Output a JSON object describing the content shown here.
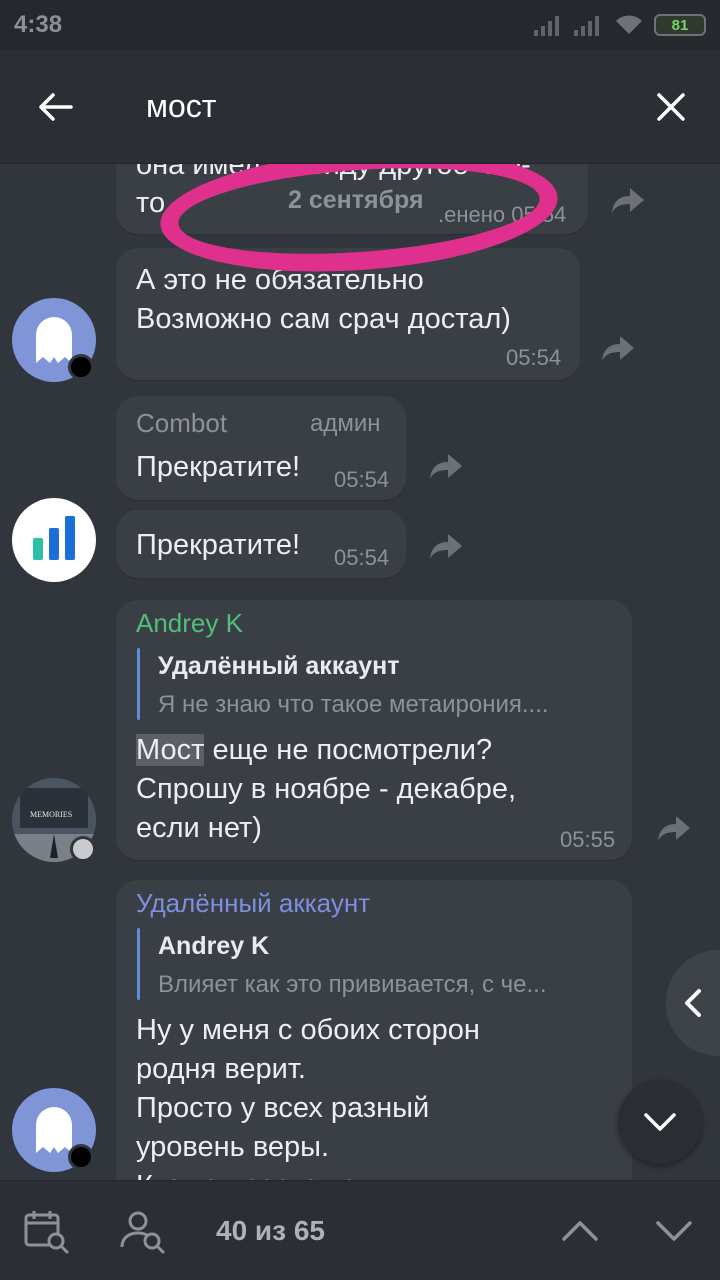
{
  "status": {
    "time": "4:38",
    "battery": "81"
  },
  "search": {
    "query": "мост"
  },
  "chat": {
    "date_divider": "2 сентября",
    "top_fragment_line1": "она имела в виду другое что-",
    "top_fragment_line2": "то",
    "top_fragment_time": ".енено 05:54",
    "msg1": {
      "text": "А это не обязательно\nВозможно сам срач достал)",
      "time": "05:54"
    },
    "combot": {
      "name": "Combot",
      "role": "админ",
      "text1": "Прекратите!",
      "time1": "05:54",
      "text2": "Прекратите!",
      "time2": "05:54"
    },
    "andrey": {
      "name": "Andrey K",
      "reply_author": "Удалённый аккаунт",
      "reply_text": "Я не знаю что такое метаирония....",
      "highlight": "Мост",
      "text_rest": " еще не посмотрели?",
      "text_lines": "Спрошу в ноябре - декабре,\nесли нет)",
      "time": "05:55",
      "avatar_caption": "MEMORIES"
    },
    "deleted": {
      "name": "Удалённый аккаунт",
      "reply_author": "Andrey K",
      "reply_text": "Влияет как это прививается, с че...",
      "text": "Ну у меня с обоих сторон\nродня верит.\nПросто у всех разный\nуровень веры.\nКто то просто ходит в"
    }
  },
  "bottom": {
    "counter": "40 из 65"
  },
  "colors": {
    "highlight_mark": "#e0308e",
    "andrey_name": "#4fbf7a",
    "deleted_name": "#7d8fe0",
    "accent_blue": "#5e8fd6"
  }
}
